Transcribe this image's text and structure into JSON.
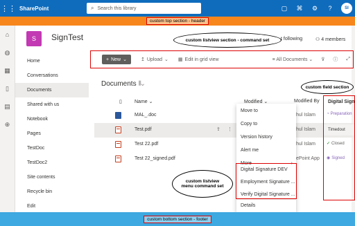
{
  "suite": {
    "app_title": "SharePoint",
    "search_placeholder": "Search this library",
    "avatar_initials": "SI",
    "accent": "#0f6cbd"
  },
  "annotations": {
    "header": "custom top section - header",
    "command_set": "custom listview section - command set",
    "field": "custom field section",
    "menu_command_set": "custom listview menu command set",
    "footer": "custom bottom section - footer"
  },
  "site": {
    "logo_letter": "S",
    "title": "SignTest",
    "following": "t following",
    "members": "4 members"
  },
  "nav": {
    "items": [
      "Home",
      "Conversations",
      "Documents",
      "Shared with us",
      "Notebook",
      "Pages",
      "TestDoc",
      "TestDoc2",
      "Site contents",
      "Recycle bin",
      "Edit"
    ]
  },
  "command_bar": {
    "new_label": "New",
    "upload_label": "Upload",
    "grid_label": "Edit in grid view",
    "view_label": "All Documents"
  },
  "library": {
    "title": "Documents",
    "columns": {
      "name": "Name",
      "modified": "Modified",
      "modified_by": "Modified By"
    },
    "files": [
      "MAL_.doc",
      "Test.pdf",
      "Test 22.pdf",
      "Test 22_signed.pdf"
    ]
  },
  "context_menu": {
    "items": [
      "Move to",
      "Copy to",
      "Version history",
      "Alert me",
      "More"
    ],
    "custom_items": [
      "Digital Signature DEV",
      "Employment Signature ...",
      "Verify Digital Signature ..."
    ],
    "details": "Details"
  },
  "modified_by": [
    "hul Islam",
    "hul Islam",
    "hul Islam",
    "ePoint App"
  ],
  "field_column": {
    "header": "Digital Sign",
    "values": [
      "Preparation",
      "Timedout",
      "Closed",
      "Signed"
    ]
  }
}
